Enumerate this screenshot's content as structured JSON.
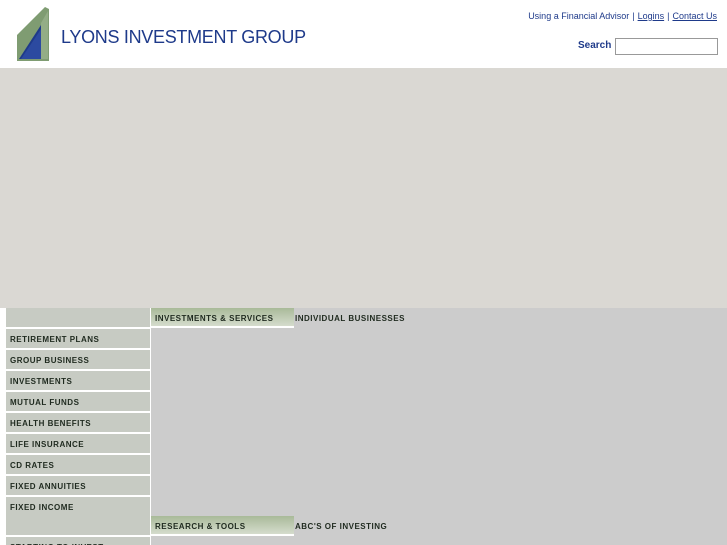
{
  "header": {
    "logo_text": "LYONS INVESTMENT GROUP",
    "links": [
      "Using a Financial Advisor",
      "Logins",
      "Contact Us"
    ],
    "link_separator": "|",
    "search_label": "Search",
    "search_value": "",
    "text_color": "#1e3a8a"
  },
  "nav": {
    "section1": {
      "head": "INVESTMENTS & SERVICES",
      "sub": "INDIVIDUAL BUSINESSES"
    },
    "section2": {
      "head": "RESEARCH & TOOLS",
      "sub": "ABC'S OF INVESTING"
    },
    "left_items": [
      "RETIREMENT PLANS",
      "GROUP BUSINESS",
      "INVESTMENTS",
      "MUTUAL FUNDS",
      "HEALTH BENEFITS",
      "LIFE INSURANCE",
      "CD RATES",
      "FIXED ANNUITIES",
      "FIXED INCOME"
    ],
    "left_items_bottom": [
      "STARTING TO INVEST"
    ]
  },
  "colors": {
    "hero_bg": "#dad8d3",
    "nav_cell_bg": "#c7cbc3",
    "content_bg": "#cccccc",
    "section_head_bg": "#a9ba99",
    "logo_green": "#7f9c72",
    "logo_blue": "#1e3a8a"
  }
}
